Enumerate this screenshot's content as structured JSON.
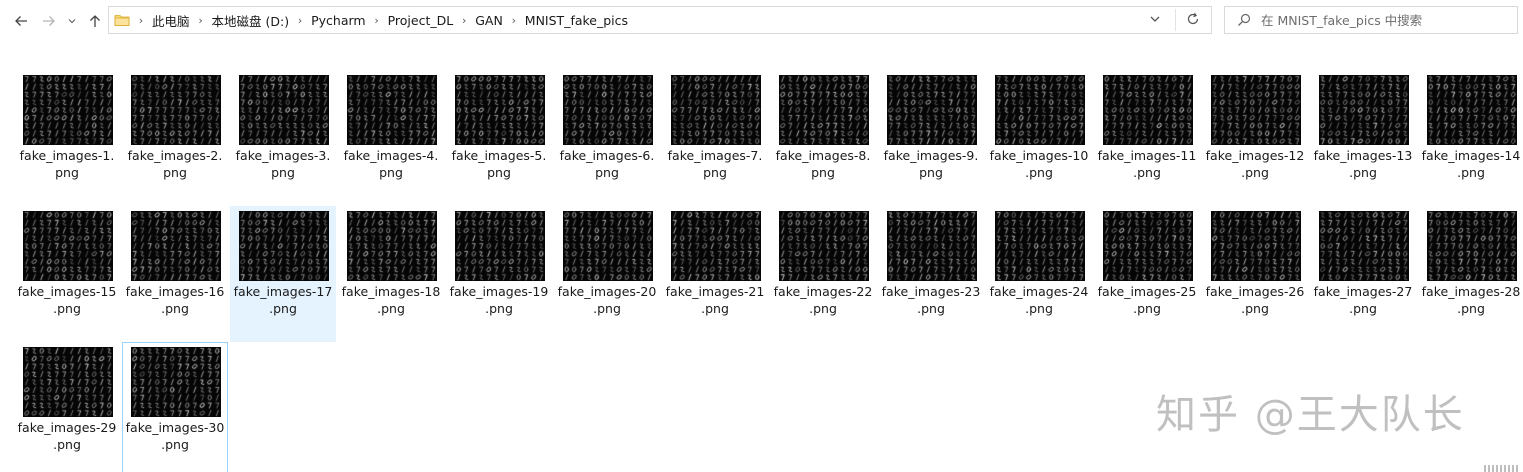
{
  "address_bar": {
    "breadcrumbs": [
      "此电脑",
      "本地磁盘 (D:)",
      "Pycharm",
      "Project_DL",
      "GAN",
      "MNIST_fake_pics"
    ]
  },
  "search": {
    "placeholder": "在 MNIST_fake_pics 中搜索"
  },
  "files": [
    {
      "line1": "fake_images-1.",
      "line2": "png"
    },
    {
      "line1": "fake_images-2.",
      "line2": "png"
    },
    {
      "line1": "fake_images-3.",
      "line2": "png"
    },
    {
      "line1": "fake_images-4.",
      "line2": "png"
    },
    {
      "line1": "fake_images-5.",
      "line2": "png"
    },
    {
      "line1": "fake_images-6.",
      "line2": "png"
    },
    {
      "line1": "fake_images-7.",
      "line2": "png"
    },
    {
      "line1": "fake_images-8.",
      "line2": "png"
    },
    {
      "line1": "fake_images-9.",
      "line2": "png"
    },
    {
      "line1": "fake_images-10",
      "line2": ".png"
    },
    {
      "line1": "fake_images-11",
      "line2": ".png"
    },
    {
      "line1": "fake_images-12",
      "line2": ".png"
    },
    {
      "line1": "fake_images-13",
      "line2": ".png"
    },
    {
      "line1": "fake_images-14",
      "line2": ".png"
    },
    {
      "line1": "fake_images-15",
      "line2": ".png"
    },
    {
      "line1": "fake_images-16",
      "line2": ".png"
    },
    {
      "line1": "fake_images-17",
      "line2": ".png"
    },
    {
      "line1": "fake_images-18",
      "line2": ".png"
    },
    {
      "line1": "fake_images-19",
      "line2": ".png"
    },
    {
      "line1": "fake_images-20",
      "line2": ".png"
    },
    {
      "line1": "fake_images-21",
      "line2": ".png"
    },
    {
      "line1": "fake_images-22",
      "line2": ".png"
    },
    {
      "line1": "fake_images-23",
      "line2": ".png"
    },
    {
      "line1": "fake_images-24",
      "line2": ".png"
    },
    {
      "line1": "fake_images-25",
      "line2": ".png"
    },
    {
      "line1": "fake_images-26",
      "line2": ".png"
    },
    {
      "line1": "fake_images-27",
      "line2": ".png"
    },
    {
      "line1": "fake_images-28",
      "line2": ".png"
    },
    {
      "line1": "fake_images-29",
      "line2": ".png"
    },
    {
      "line1": "fake_images-30",
      "line2": ".png"
    }
  ],
  "selected_file": "fake_images-17.png",
  "focused_file": "fake_images-30.png",
  "watermark": "知乎 @王大队长",
  "colors": {
    "selection": "#e5f3ff",
    "focus_border": "#99d1ff",
    "folder": "#f8d775"
  }
}
